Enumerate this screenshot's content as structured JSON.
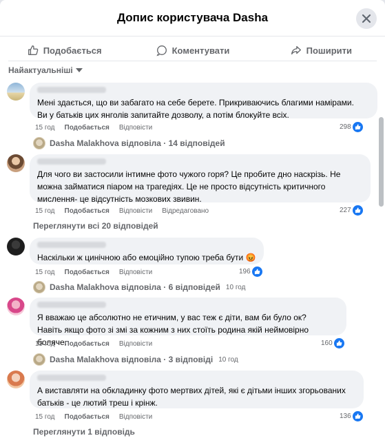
{
  "header": {
    "title": "Допис користувача Dasha"
  },
  "actions": {
    "like": "Подобається",
    "comment": "Коментувати",
    "share": "Поширити"
  },
  "sort": {
    "label": "Найактуальніші"
  },
  "comments": [
    {
      "text": "Мені здається, що ви забагато на себе берете. Прикриваючись благими намірами.\nВи у батьків цих янголів запитайте дозволу, а потім блокуйте всіх.",
      "time": "15 год",
      "like": "Подобається",
      "reply": "Відповісти",
      "reactions": "298",
      "replies_summary": {
        "name": "Dasha Malakhova відповіла · 14 відповідей"
      }
    },
    {
      "text": "Для чого ви застосили інтимне фото чужого горя? Це пробите дно наскрізь. Не\nможна займатися піаром на трагедіях. Це не просто відсутність критичного\nмислення- це відсутність мозкових звивин.",
      "time": "15 год",
      "like": "Подобається",
      "reply": "Відповісти",
      "edited": "Відредаговано",
      "reactions": "227",
      "view_more": "Переглянути всі 20 відповідей"
    },
    {
      "text": "Наскільки ж цинічною або емоційно тупою треба бути 😡",
      "time": "15 год",
      "like": "Подобається",
      "reply": "Відповісти",
      "reactions": "196",
      "replies_summary": {
        "name": "Dasha Malakhova відповіла · 6 відповідей",
        "time": "10 год"
      }
    },
    {
      "text": "Я вважаю це абсолютно не етичним, у вас теж є діти, вам би було ок?\nНавіть якщо фото зі змі за кожним з них стоїть родина якій неймовірно боляче.",
      "time": "15 год",
      "like": "Подобається",
      "reply": "Відповісти",
      "reactions": "160",
      "replies_summary": {
        "name": "Dasha Malakhova відповіла · 3 відповіді",
        "time": "10 год"
      }
    },
    {
      "text": "А виставляти на обкладинку фото мертвих дітей, які є дітьми інших згорьованих\nбатьків - це лютий треш і крінж.",
      "time": "15 год",
      "like": "Подобається",
      "reply": "Відповісти",
      "reactions": "136",
      "view_more": "Переглянути 1 відповідь"
    }
  ],
  "colors": {
    "accent": "#1877f2",
    "bubble": "#f0f2f5",
    "muted": "#65676b"
  }
}
